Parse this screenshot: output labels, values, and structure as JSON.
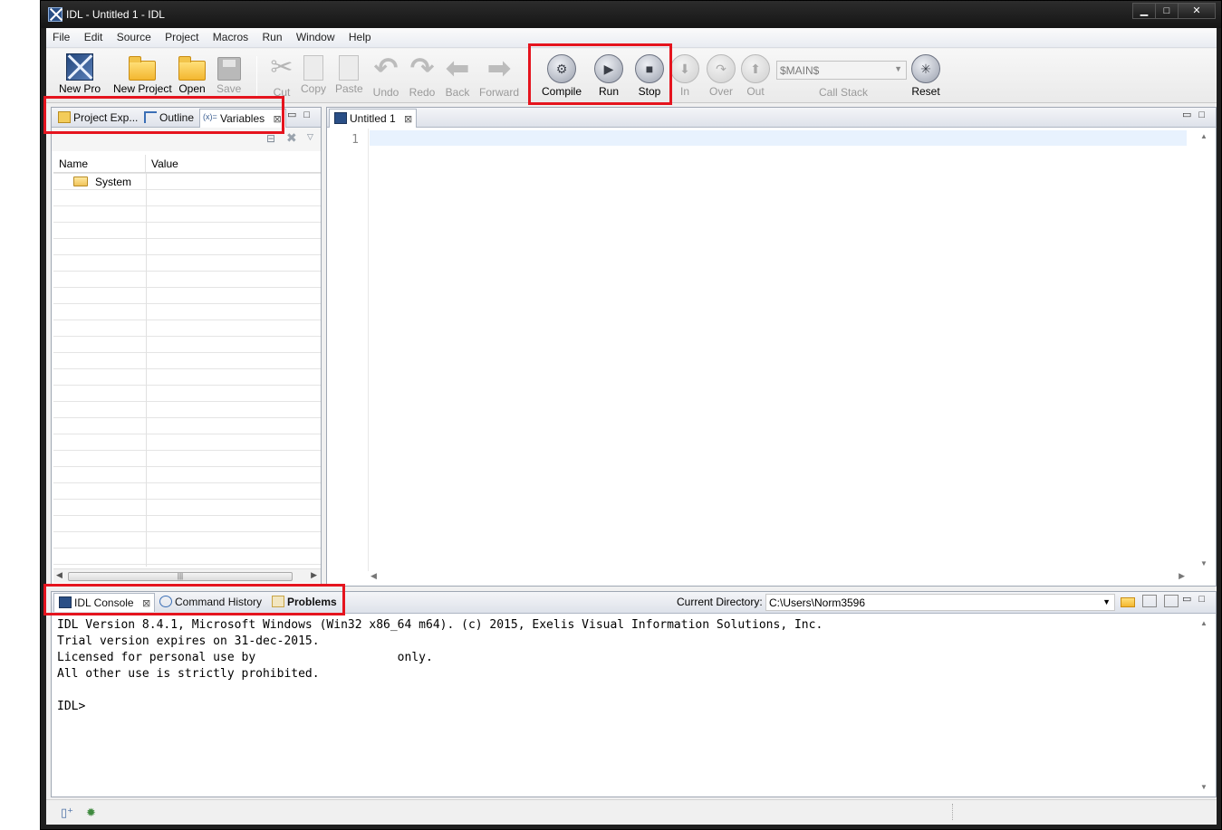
{
  "window": {
    "title": "IDL - Untitled 1 - IDL",
    "buttons": {
      "minimize": "▁",
      "maximize": "□",
      "close": "✕"
    }
  },
  "menu": [
    "File",
    "Edit",
    "Source",
    "Project",
    "Macros",
    "Run",
    "Window",
    "Help"
  ],
  "toolbar": {
    "new_pro": "New Pro",
    "new_project": "New Project",
    "open": "Open",
    "save": "Save",
    "cut": "Cut",
    "copy": "Copy",
    "paste": "Paste",
    "undo": "Undo",
    "redo": "Redo",
    "back": "Back",
    "forward": "Forward",
    "compile": "Compile",
    "run": "Run",
    "stop": "Stop",
    "step_in": "In",
    "step_over": "Over",
    "step_out": "Out",
    "call_stack_value": "$MAIN$",
    "call_stack_label": "Call Stack",
    "reset": "Reset"
  },
  "left_panel": {
    "tabs": [
      "Project Exp...",
      "Outline",
      "Variables"
    ],
    "columns": [
      "Name",
      "Value"
    ],
    "rows": [
      {
        "name": "System",
        "value": ""
      }
    ]
  },
  "editor": {
    "tab": "Untitled 1",
    "line_number": "1"
  },
  "console": {
    "tabs": [
      "IDL Console",
      "Command History",
      "Problems"
    ],
    "current_directory_label": "Current Directory:",
    "current_directory": "C:\\Users\\Norm3596",
    "lines": [
      "IDL Version 8.4.1, Microsoft Windows (Win32 x86_64 m64). (c) 2015, Exelis Visual Information Solutions, Inc.",
      "Trial version expires on 31-dec-2015.",
      "Licensed for personal use by                    only.",
      "All other use is strictly prohibited.",
      "",
      "IDL>"
    ]
  },
  "colors": {
    "highlight": "#e5141e",
    "current_line": "#e8f2fe"
  }
}
